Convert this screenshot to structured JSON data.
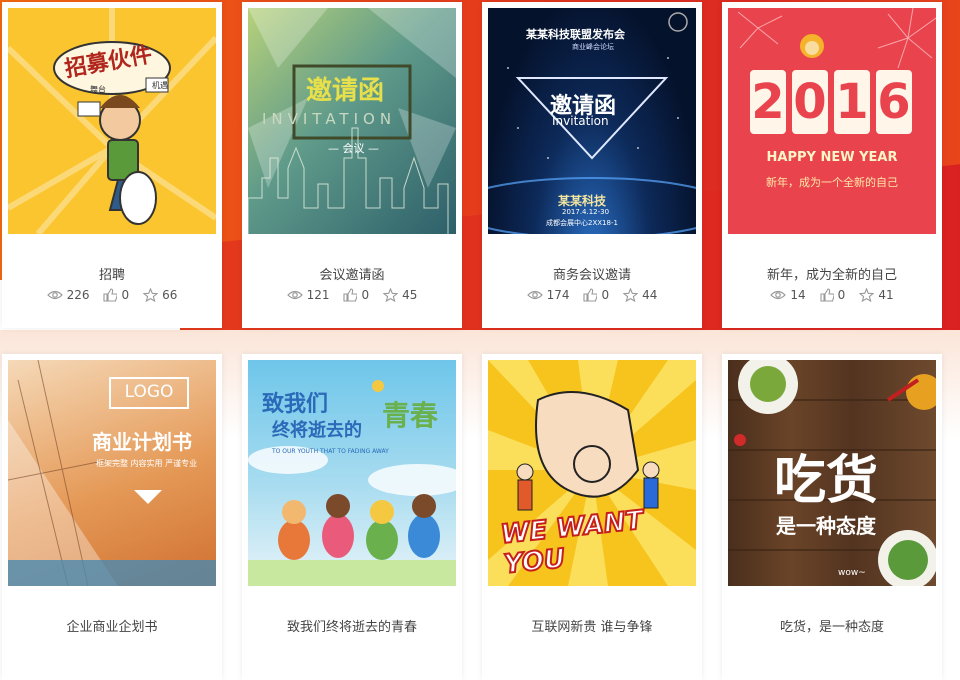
{
  "cards": [
    {
      "title": "招聘",
      "views": "226",
      "likes": "0",
      "favorites": "66",
      "thumb": {
        "headline": "招募伙件",
        "bubble_left": "舞台",
        "bubble_right": "机遇"
      }
    },
    {
      "title": "会议邀请函",
      "views": "121",
      "likes": "0",
      "favorites": "45",
      "thumb": {
        "headline": "邀请函",
        "sub": "INVITATION",
        "tag": "— 会议 —"
      }
    },
    {
      "title": "商务会议邀请",
      "views": "174",
      "likes": "0",
      "favorites": "44",
      "thumb": {
        "top": "某某科技联盟发布会",
        "sub_top": "商业峰会论坛",
        "headline": "邀请函",
        "en": "Invitation",
        "company": "某某科技",
        "date": "2017.4.12-30",
        "place": "成都会展中心2XX18-1"
      }
    },
    {
      "title": "新年，成为全新的自己",
      "views": "14",
      "likes": "0",
      "favorites": "41",
      "thumb": {
        "year": [
          "2",
          "0",
          "1",
          "6"
        ],
        "greeting": "HAPPY NEW YEAR",
        "slogan": "新年，成为一个全新的自己"
      }
    },
    {
      "title": "企业商业企划书",
      "thumb": {
        "logo": "LOGO",
        "headline": "商业计划书",
        "sub": "框架完整 内容实用 严谨专业"
      }
    },
    {
      "title": "致我们终将逝去的青春",
      "thumb": {
        "line1": "致我们",
        "line2": "终将逝去的",
        "accent": "青春",
        "en": "TO OUR YOUTH THAT TO FADING AWAY"
      }
    },
    {
      "title": "互联网新贵 谁与争锋",
      "thumb": {
        "headline": "WE WANT YOU"
      }
    },
    {
      "title": "吃货，是一种态度",
      "thumb": {
        "headline": "吃货",
        "sub": "是一种态度",
        "tag": "wow~"
      }
    }
  ],
  "icons": {
    "views": "eye-icon",
    "likes": "thumbs-up-icon",
    "favorites": "star-icon"
  },
  "colors": {
    "accent_orange": "#f36b10",
    "accent_red": "#dc2a22",
    "yellow": "#fbc02d"
  }
}
